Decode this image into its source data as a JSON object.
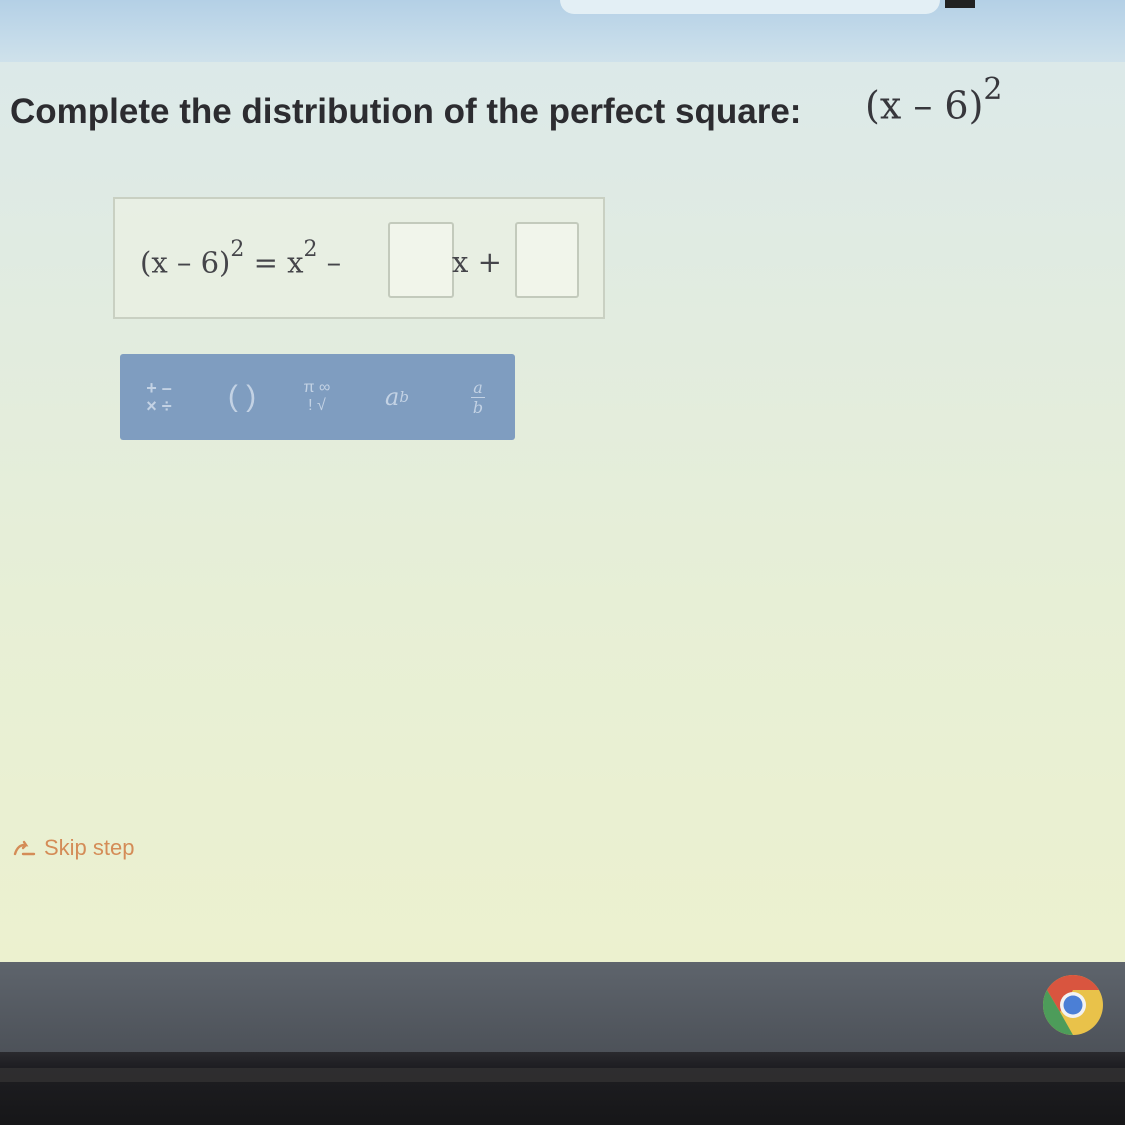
{
  "question": {
    "prompt": "Complete the distribution of the perfect square:",
    "math_base": "(x – 6)",
    "math_exponent": "2"
  },
  "answer": {
    "lhs_base": "(x – 6)",
    "lhs_exponent": "2",
    "equals_part": " = x",
    "x_exponent": "2",
    "minus": " – ",
    "middle_term_suffix": "x +",
    "blank1_value": "",
    "blank2_value": ""
  },
  "toolbar": {
    "ops_top": "+ –",
    "ops_bottom": "× ÷",
    "parens_label": "( )",
    "special_top": "π ∞",
    "special_bottom": "! √",
    "power_base": "a",
    "power_exp": "b",
    "frac_num": "a",
    "frac_den": "b"
  },
  "skip": {
    "label": "Skip step",
    "icon": "skip-arrow-icon"
  },
  "taskbar": {
    "app_icon": "chrome-icon"
  },
  "colors": {
    "toolbar_bg": "#7f9dc0",
    "skip_color": "#d2824a",
    "text_color": "#2c2c30"
  }
}
